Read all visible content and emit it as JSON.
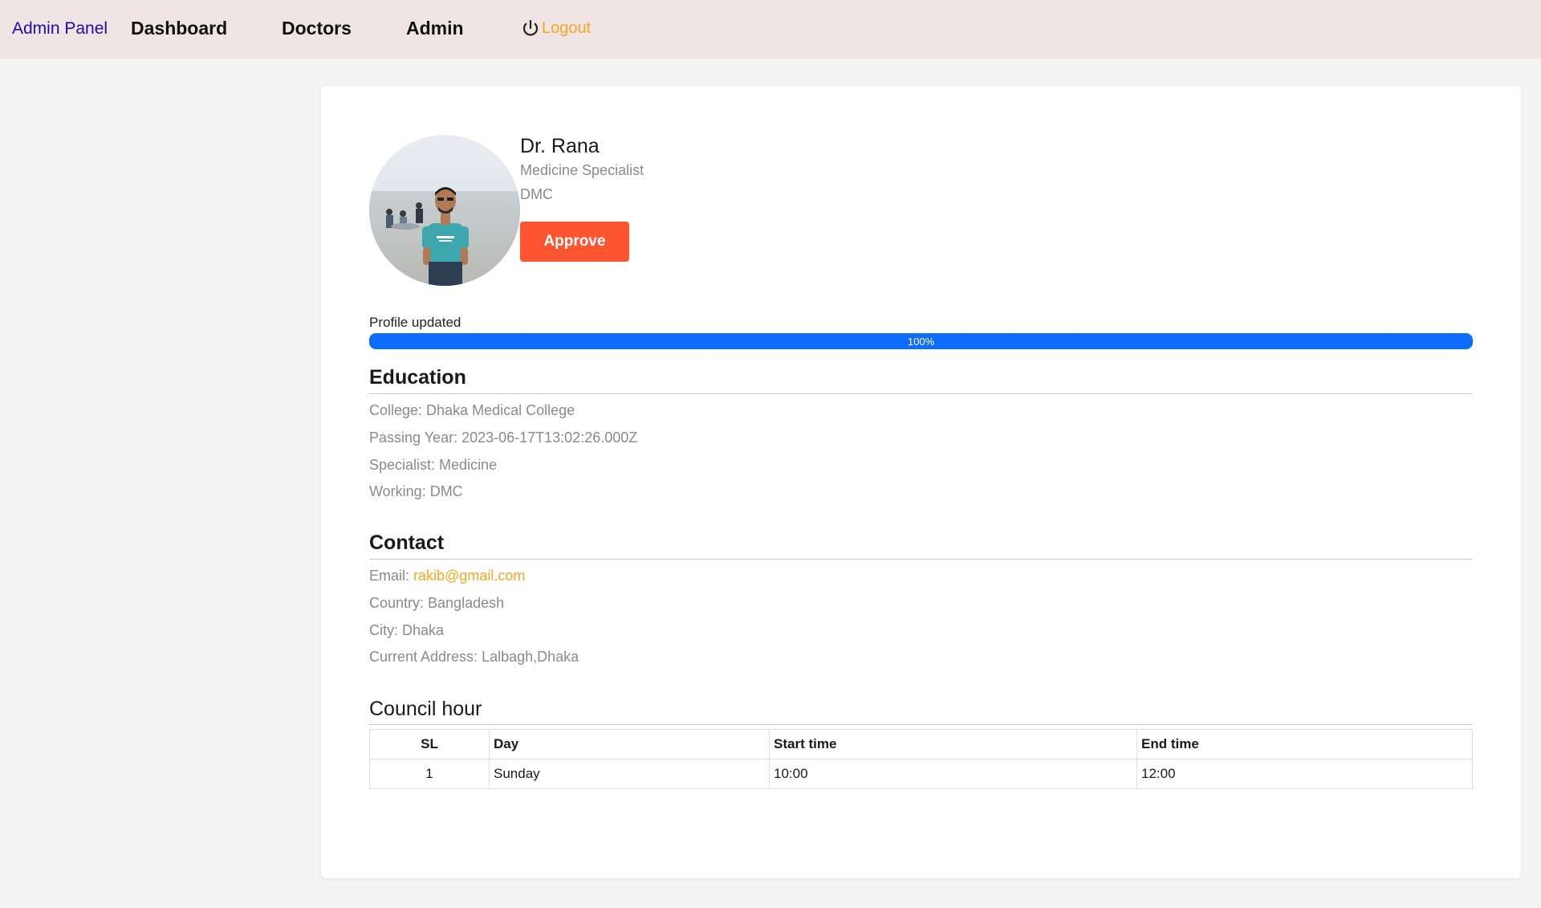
{
  "nav": {
    "brand": "Admin Panel",
    "links": [
      "Dashboard",
      "Doctors",
      "Admin"
    ],
    "logout": "Logout",
    "logout_icon": "power-icon"
  },
  "doctor": {
    "name": "Dr. Rana",
    "specialty": "Medicine Specialist",
    "workplace": "DMC",
    "approve_label": "Approve"
  },
  "progress": {
    "label": "Profile updated",
    "value_percent": 100,
    "text": "100%"
  },
  "education": {
    "title": "Education",
    "lines": [
      "College: Dhaka Medical College",
      "Passing Year: 2023-06-17T13:02:26.000Z",
      "Specialist: Medicine",
      "Working: DMC"
    ]
  },
  "contact": {
    "title": "Contact",
    "email_label": "Email: ",
    "email": "rakib@gmail.com",
    "lines": [
      "Country: Bangladesh",
      "City: Dhaka",
      "Current Address: Lalbagh,Dhaka"
    ]
  },
  "council": {
    "title": "Council hour",
    "headers": [
      "SL",
      "Day",
      "Start time",
      "End time"
    ],
    "rows": [
      [
        "1",
        "Sunday",
        "10:00",
        "12:00"
      ]
    ]
  },
  "colors": {
    "nav_bg": "#f1e4e5",
    "approve": "#fd5530",
    "progress": "#0d6efd",
    "link_accent": "#f5a623",
    "brand_link": "#1a0dab"
  }
}
